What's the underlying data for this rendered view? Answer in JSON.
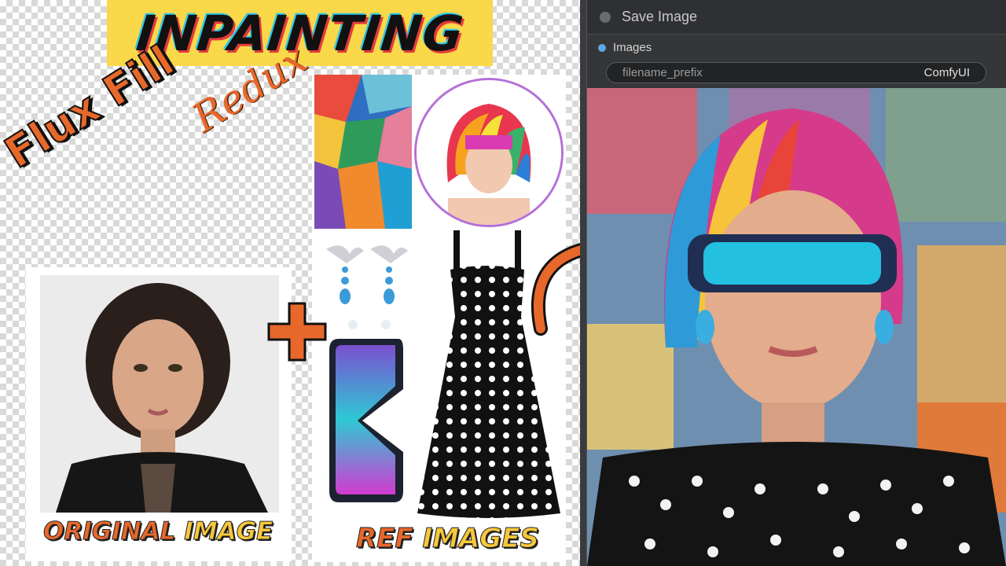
{
  "title": "INPAINTING",
  "subtitle": {
    "flux_fill": "Flux Fill",
    "redux": "Redux"
  },
  "labels": {
    "original_part1": "ORIGINAL",
    "original_part2": "IMAGE",
    "ref_part1": "REF",
    "ref_part2": "IMAGES"
  },
  "node": {
    "title": "Save Image",
    "output_label": "Images",
    "field_name": "filename_prefix",
    "field_value": "ComfyUI"
  },
  "colors": {
    "banner_yellow": "#f9d84a",
    "accent_orange": "#e7682a",
    "node_bg": "#353638"
  },
  "icons": [
    "plus-icon",
    "curved-arrow-icon",
    "status-dot-icon",
    "output-dot-icon"
  ]
}
